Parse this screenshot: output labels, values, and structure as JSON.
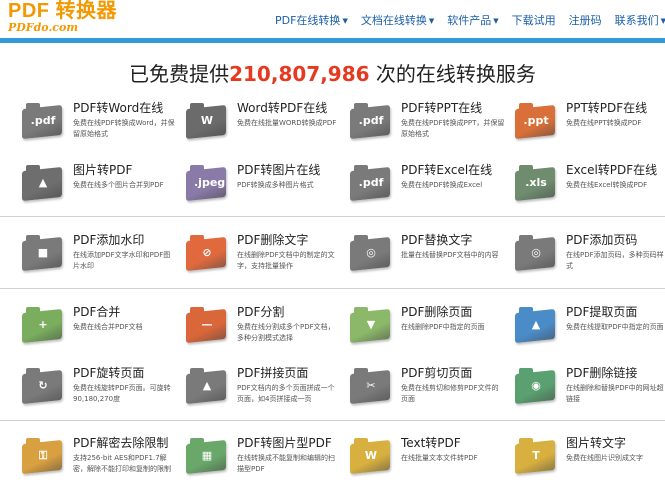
{
  "logo": {
    "main": "PDF 转换器",
    "sub": "PDFdo.com"
  },
  "nav": [
    {
      "label": "PDF在线转换",
      "dropdown": true
    },
    {
      "label": "文档在线转换",
      "dropdown": true
    },
    {
      "label": "软件产品",
      "dropdown": true
    },
    {
      "label": "下载试用",
      "dropdown": false
    },
    {
      "label": "注册码",
      "dropdown": false
    },
    {
      "label": "联系我们",
      "dropdown": true
    }
  ],
  "headline": {
    "prefix": "已免费提供",
    "count": "210,807,986",
    "suffix": " 次的在线转换服务"
  },
  "colors": {
    "accent": "#f39800",
    "nav": "#1a5fa8",
    "band": "#3399dd",
    "count": "#e6391f"
  },
  "tools": [
    {
      "title": "PDF转Word在线",
      "desc": "免费在线PDF转换成Word，并保留原始格式",
      "icon": "pdf-folder-icon",
      "sym": ".pdf",
      "color": "#7a7a7a"
    },
    {
      "title": "Word转PDF在线",
      "desc": "免费在线批量WORD转换成PDF",
      "icon": "word-folder-icon",
      "sym": "W",
      "color": "#6b6b6b"
    },
    {
      "title": "PDF转PPT在线",
      "desc": "免费在线PDF转换成PPT，并保留原始格式",
      "icon": "pdf-folder-icon",
      "sym": ".pdf",
      "color": "#7a7a7a"
    },
    {
      "title": "PPT转PDF在线",
      "desc": "免费在线PPT转换成PDF",
      "icon": "ppt-folder-icon",
      "sym": ".ppt",
      "color": "#d9703a"
    },
    {
      "title": "图片转PDF",
      "desc": "免费在线多个图片合并到PDF",
      "icon": "image-folder-icon",
      "sym": "▲",
      "color": "#6e6e6e"
    },
    {
      "title": "PDF转图片在线",
      "desc": "PDF转换成多种图片格式",
      "icon": "jpeg-folder-icon",
      "sym": ".jpeg",
      "color": "#8a7aa8"
    },
    {
      "title": "PDF转Excel在线",
      "desc": "免费在线PDF转换成Excel",
      "icon": "pdf-folder-icon",
      "sym": ".pdf",
      "color": "#7a7a7a"
    },
    {
      "title": "Excel转PDF在线",
      "desc": "免费在线Excel转换成PDF",
      "icon": "xls-folder-icon",
      "sym": ".xls",
      "color": "#6f8c6f"
    },
    {
      "title": "PDF添加水印",
      "desc": "在线添加PDF文字水印和PDF图片水印",
      "icon": "watermark-folder-icon",
      "sym": "■",
      "color": "#7a7a7a"
    },
    {
      "title": "PDF删除文字",
      "desc": "在线删除PDF文档中的制定的文字，支持批量操作",
      "icon": "delete-text-folder-icon",
      "sym": "⊘",
      "color": "#e06a3e"
    },
    {
      "title": "PDF替换文字",
      "desc": "批量在线替换PDF文档中的内容",
      "icon": "replace-text-folder-icon",
      "sym": "◎",
      "color": "#7a7a7a"
    },
    {
      "title": "PDF添加页码",
      "desc": "在线PDF添加页码，多种页码样式",
      "icon": "page-number-folder-icon",
      "sym": "◎",
      "color": "#7a7a7a"
    },
    {
      "title": "PDF合并",
      "desc": "免费在线合并PDF文档",
      "icon": "merge-folder-icon",
      "sym": "+",
      "color": "#7aae5e"
    },
    {
      "title": "PDF分割",
      "desc": "免费在线分割成多个PDF文档，多种分割模式选择",
      "icon": "split-folder-icon",
      "sym": "—",
      "color": "#d9673a"
    },
    {
      "title": "PDF删除页面",
      "desc": "在线删除PDF中指定的页面",
      "icon": "delete-page-folder-icon",
      "sym": "▼",
      "color": "#8cb86a"
    },
    {
      "title": "PDF提取页面",
      "desc": "免费在线提取PDF中指定的页面",
      "icon": "extract-page-folder-icon",
      "sym": "▲",
      "color": "#4a8cc8"
    },
    {
      "title": "PDF旋转页面",
      "desc": "免费在线旋转PDF页面。可旋转90,180,270度",
      "icon": "rotate-folder-icon",
      "sym": "↻",
      "color": "#7a7a7a"
    },
    {
      "title": "PDF拼接页面",
      "desc": "PDF文档内的多个页面拼成一个页面，如4页拼接成一页",
      "icon": "join-page-folder-icon",
      "sym": "▲",
      "color": "#7a7a7a"
    },
    {
      "title": "PDF剪切页面",
      "desc": "免费在线剪切和修剪PDF文件的页面",
      "icon": "scissors-folder-icon",
      "sym": "✂",
      "color": "#7a7a7a"
    },
    {
      "title": "PDF删除链接",
      "desc": "在线删除和替换PDF中的网址超链接",
      "icon": "globe-folder-icon",
      "sym": "◉",
      "color": "#5aa070"
    },
    {
      "title": "PDF解密去除限制",
      "desc": "支持256-bit AES和PDF1.7解密，解除不能打印和复制的限制",
      "icon": "key-folder-icon",
      "sym": "⚿",
      "color": "#d8a040"
    },
    {
      "title": "PDF转图片型PDF",
      "desc": "在线转换成不能复制和编辑的扫描型PDF",
      "icon": "image-pdf-folder-icon",
      "sym": "▦",
      "color": "#6aa86a"
    },
    {
      "title": "Text转PDF",
      "desc": "在线批量文本文件转PDF",
      "icon": "text-folder-icon",
      "sym": "W",
      "color": "#d8b040"
    },
    {
      "title": "图片转文字",
      "desc": "免费在线图片识别成文字",
      "icon": "ocr-folder-icon",
      "sym": "T",
      "color": "#d8b040"
    }
  ]
}
